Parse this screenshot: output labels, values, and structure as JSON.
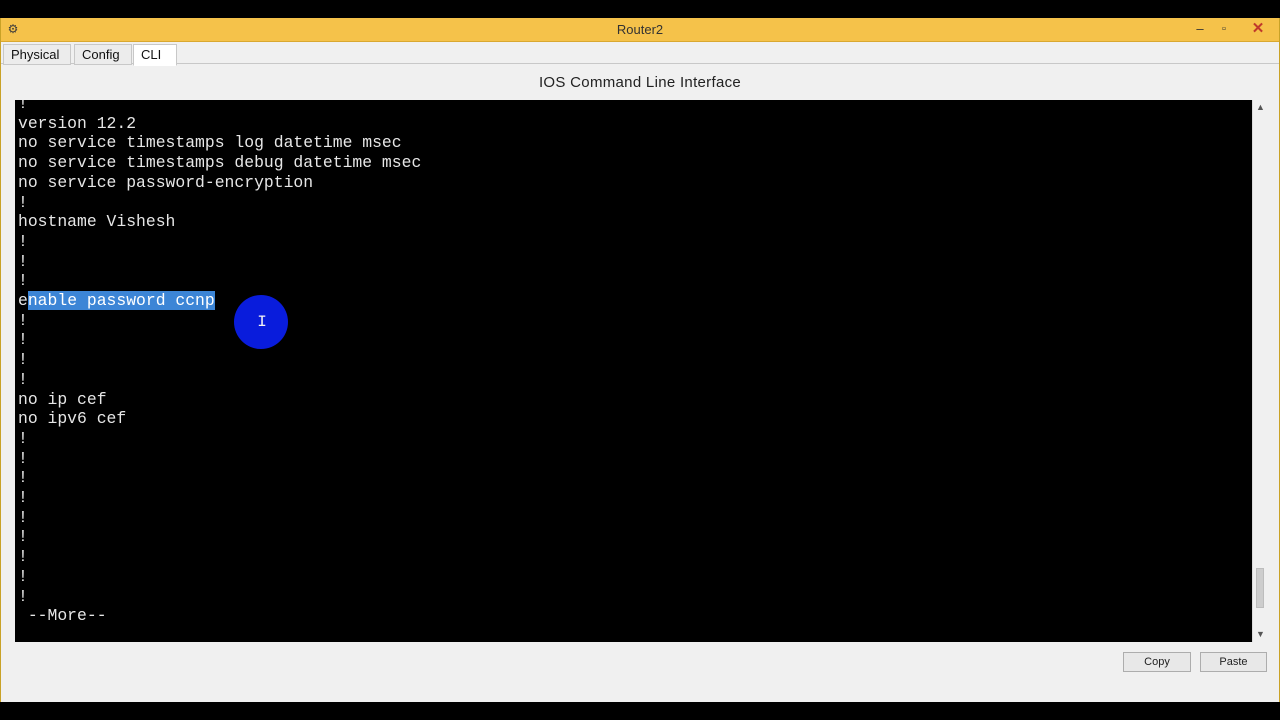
{
  "window": {
    "title": "Router2",
    "icon": "packet-tracer-app-icon",
    "controls": {
      "minimize": "–",
      "maximize": "▫",
      "close": "✕"
    }
  },
  "tabs": [
    {
      "label": "Physical",
      "active": false
    },
    {
      "label": "Config",
      "active": false
    },
    {
      "label": "CLI",
      "active": true
    }
  ],
  "pane_title": "IOS Command Line Interface",
  "terminal": {
    "background": "#000000",
    "foreground": "#e6e6e6",
    "selection_color": "#3c85d6",
    "lines": [
      "!",
      "version 12.2",
      "no service timestamps log datetime msec",
      "no service timestamps debug datetime msec",
      "no service password-encryption",
      "!",
      "hostname Vishesh",
      "!",
      "!",
      "!",
      "enable password ccnp",
      "!",
      "!",
      "!",
      "!",
      "no ip cef",
      "no ipv6 cef",
      "!",
      "!",
      "!",
      "!",
      "!",
      "!",
      "!",
      "!",
      "!",
      " --More--"
    ],
    "selected_line": {
      "prefix": "e",
      "selected": "nable password ccnp"
    }
  },
  "buttons": {
    "copy": "Copy",
    "paste": "Paste"
  },
  "cursor": {
    "glyph": "I",
    "highlight_color": "#0a1ee8"
  },
  "scrollbar": {
    "up": "▲",
    "down": "▼"
  }
}
